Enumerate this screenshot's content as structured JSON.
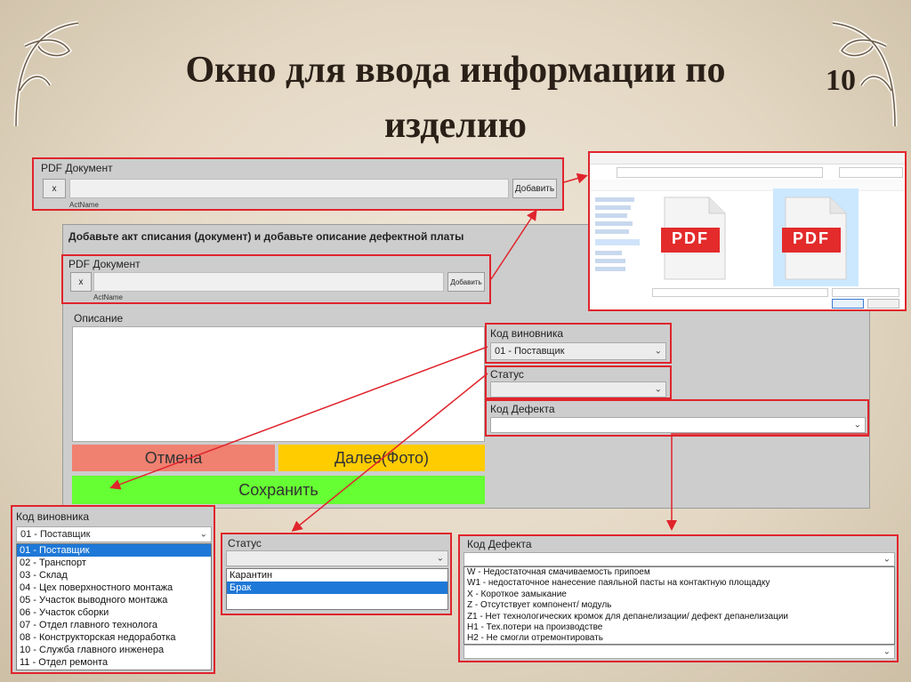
{
  "slide": {
    "title_line1": "Окно для ввода информации по",
    "title_line2": "изделию",
    "number": "10"
  },
  "top_doc": {
    "label": "PDF Документ",
    "x_button": "x",
    "add_button": "Добавить",
    "caption": "ActName"
  },
  "main_window": {
    "header": "Добавьте акт списания (документ) и добавьте описание дефектной платы",
    "doc": {
      "label": "PDF Документ",
      "x_button": "x",
      "add_button": "Добавить",
      "caption": "ActName"
    },
    "description_label": "Описание",
    "culprit": {
      "label": "Код виновника",
      "value": "01 - Поставщик"
    },
    "status": {
      "label": "Статус",
      "value": ""
    },
    "defect": {
      "label": "Код Дефекта",
      "value": ""
    },
    "buttons": {
      "cancel": "Отмена",
      "next": "Далее(Фото)",
      "save": "Сохранить"
    },
    "colors": {
      "cancel": "#f08070",
      "next": "#ffcc00",
      "save": "#66ff33"
    }
  },
  "file_dialog": {
    "file_icon_text": "PDF",
    "file_icon_color": "#e32b2b"
  },
  "culprit_dropdown": {
    "label": "Код виновника",
    "selected": "01 - Поставщик",
    "options": [
      "01 - Поставщик",
      "02 - Транспорт",
      "03 - Склад",
      "04 - Цех поверхностного монтажа",
      "05 - Участок выводного монтажа",
      "06 - Участок сборки",
      "07 - Отдел главного технолога",
      "08 - Конструкторская недоработка",
      "10 - Служба главного инженера",
      "11 - Отдел ремонта"
    ],
    "highlighted_index": 0
  },
  "status_dropdown": {
    "label": "Статус",
    "options": [
      "Карантин",
      "Брак",
      ""
    ],
    "highlighted_index": 1
  },
  "defect_dropdown": {
    "label": "Код Дефекта",
    "options": [
      "W - Недостаточная смачиваемость припоем",
      "W1 - недостаточное нанесение паяльной пасты на контактную площадку",
      "X - Короткое замыкание",
      "Z - Отсутствует компонент/ модуль",
      "Z1 - Нет технологических кромок для депанелизации/ дефект депанелизации",
      "H1 - Тех.потери на производстве",
      "H2 - Не смогли отремонтировать"
    ]
  }
}
